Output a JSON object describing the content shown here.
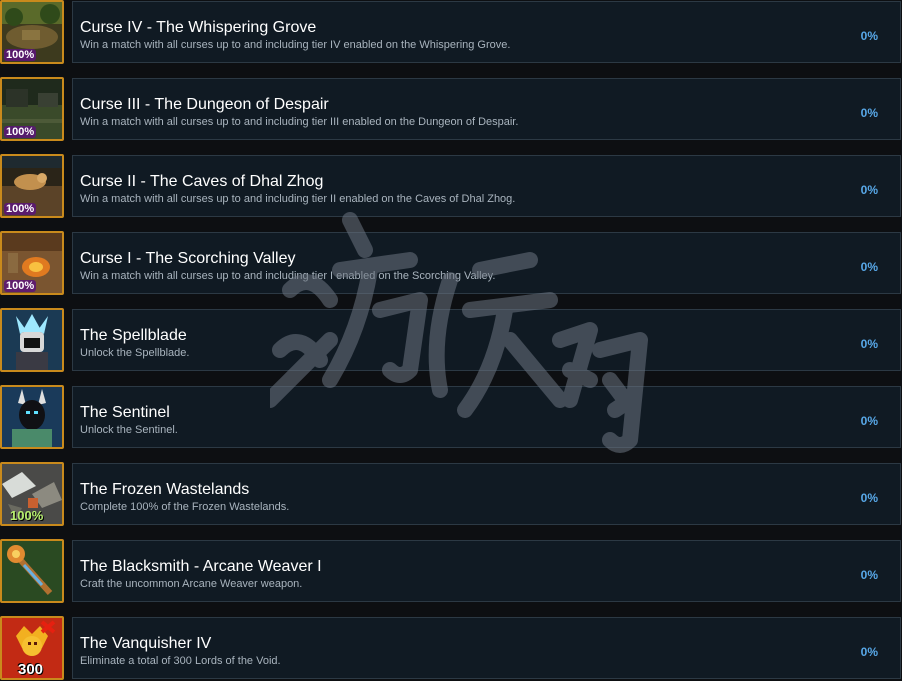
{
  "achievements": [
    {
      "title": "Curse IV - The Whispering Grove",
      "description": "Win a match with all curses up to and including tier IV enabled on the Whispering Grove.",
      "percent": "0%",
      "icon": "whispering-grove-icon",
      "badge": "100%"
    },
    {
      "title": "Curse III - The Dungeon of Despair",
      "description": "Win a match with all curses up to and including tier III enabled on the Dungeon of Despair.",
      "percent": "0%",
      "icon": "dungeon-of-despair-icon",
      "badge": "100%"
    },
    {
      "title": "Curse II - The Caves of Dhal Zhog",
      "description": "Win a match with all curses up to and including tier II enabled on the Caves of Dhal Zhog.",
      "percent": "0%",
      "icon": "caves-of-dhal-zhog-icon",
      "badge": "100%"
    },
    {
      "title": "Curse I - The Scorching Valley",
      "description": "Win a match with all curses up to and including tier I enabled on the Scorching Valley.",
      "percent": "0%",
      "icon": "scorching-valley-icon",
      "badge": "100%"
    },
    {
      "title": "The Spellblade",
      "description": "Unlock the Spellblade.",
      "percent": "0%",
      "icon": "spellblade-icon",
      "badge": ""
    },
    {
      "title": "The Sentinel",
      "description": "Unlock the Sentinel.",
      "percent": "0%",
      "icon": "sentinel-icon",
      "badge": ""
    },
    {
      "title": "The Frozen Wastelands",
      "description": "Complete 100% of the Frozen Wastelands.",
      "percent": "0%",
      "icon": "frozen-wastelands-icon",
      "badge": "100%"
    },
    {
      "title": "The Blacksmith - Arcane Weaver I",
      "description": "Craft the uncommon Arcane Weaver weapon.",
      "percent": "0%",
      "icon": "arcane-weaver-staff-icon",
      "badge": ""
    },
    {
      "title": "The Vanquisher IV",
      "description": "Eliminate a total of 300 Lords of the Void.",
      "percent": "0%",
      "icon": "vanquisher-skull-icon",
      "badge": "300"
    }
  ],
  "colors": {
    "accent_percent": "#58a8e8",
    "icon_border": "#c98a1c",
    "panel_bg": "#101a23"
  },
  "watermark": "游侠网"
}
